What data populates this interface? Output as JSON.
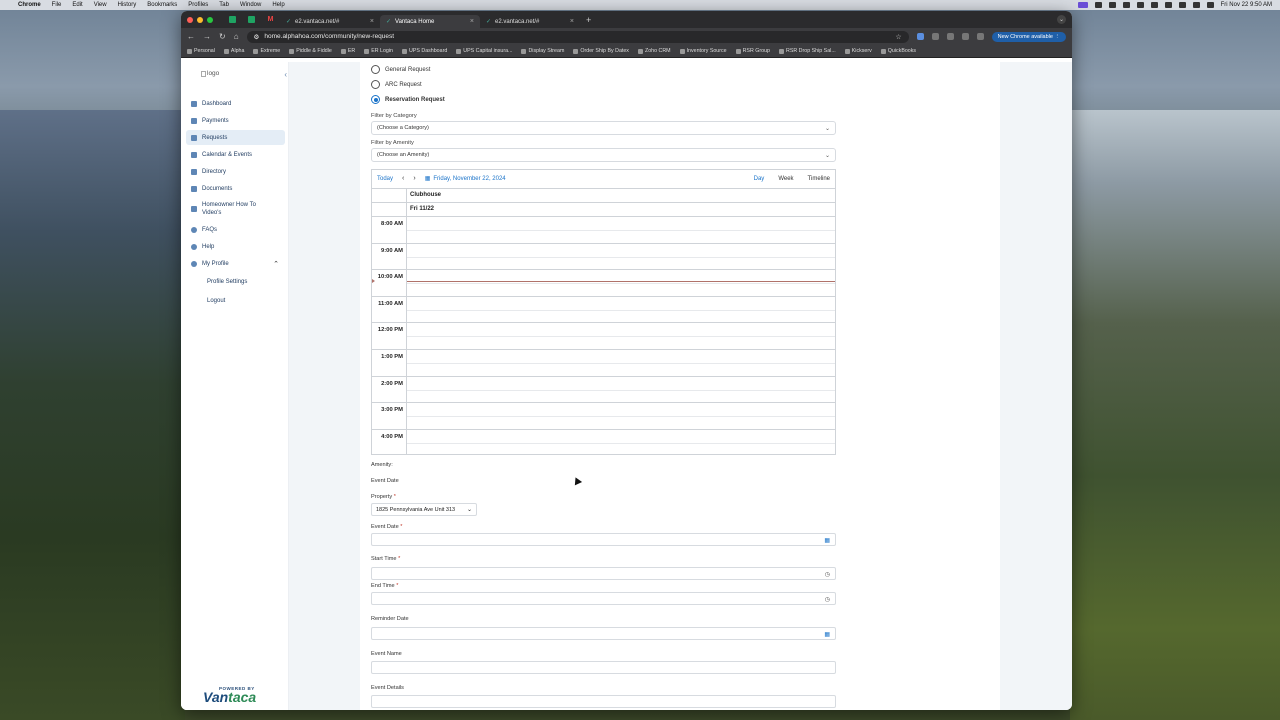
{
  "menubar": {
    "app": "Chrome",
    "items": [
      "File",
      "Edit",
      "View",
      "History",
      "Bookmarks",
      "Profiles",
      "Tab",
      "Window",
      "Help"
    ],
    "clock": "Fri Nov 22  9:50 AM"
  },
  "browser": {
    "tabs": [
      {
        "label": "e2.vantaca.net/#",
        "active": false
      },
      {
        "label": "Vantaca Home",
        "active": true
      },
      {
        "label": "e2.vantaca.net/#",
        "active": false
      }
    ],
    "url": "home.alphahoa.com/community/new-request",
    "new_chrome_label": "New Chrome available",
    "bookmarks": [
      "Personal",
      "Alpha",
      "Extreme",
      "Piddle & Fiddle",
      "ER",
      "ER Login",
      "UPS Dashboard",
      "UPS Capital insura...",
      "Display Stream",
      "Order Ship By Datex",
      "Zoho CRM",
      "Inventory Source",
      "RSR Group",
      "RSR Drop Ship Sal...",
      "Kickserv",
      "QuickBooks"
    ]
  },
  "sidebar": {
    "logo_alt": "logo",
    "items": [
      {
        "label": "Dashboard",
        "icon": "dashboard-icon",
        "active": false
      },
      {
        "label": "Payments",
        "icon": "payments-icon",
        "active": false
      },
      {
        "label": "Requests",
        "icon": "requests-icon",
        "active": true
      },
      {
        "label": "Calendar & Events",
        "icon": "calendar-icon",
        "active": false
      },
      {
        "label": "Directory",
        "icon": "directory-icon",
        "active": false
      },
      {
        "label": "Documents",
        "icon": "documents-icon",
        "active": false
      },
      {
        "label": "Homeowner How To Video's",
        "icon": "video-icon",
        "active": false
      },
      {
        "label": "FAQs",
        "icon": "faq-icon",
        "active": false
      },
      {
        "label": "Help",
        "icon": "help-icon",
        "active": false
      },
      {
        "label": "My Profile",
        "icon": "profile-icon",
        "active": false
      }
    ],
    "profile_sub": [
      "Profile Settings",
      "Logout"
    ],
    "powered_by": "POWERED BY",
    "brand_a": "Van",
    "brand_b": "taca"
  },
  "form": {
    "request_types": [
      {
        "label": "General Request",
        "selected": false
      },
      {
        "label": "ARC Request",
        "selected": false
      },
      {
        "label": "Reservation Request",
        "selected": true
      }
    ],
    "filter_category_label": "Filter by Category",
    "filter_category_value": "(Choose a Category)",
    "filter_amenity_label": "Filter by Amenity",
    "filter_amenity_value": "(Choose an Amenity)",
    "amenity_label": "Amenity:",
    "event_date_heading": "Event Date",
    "property_label": "Property",
    "property_value": "1825 Pennsylvania Ave Unit 313",
    "event_date_label": "Event Date",
    "start_time_label": "Start Time",
    "end_time_label": "End Time",
    "reminder_date_label": "Reminder Date",
    "event_name_label": "Event Name",
    "event_details_label": "Event Details",
    "required_mark": "*"
  },
  "calendar": {
    "today_label": "Today",
    "date_label": "Friday, November 22, 2024",
    "views": [
      "Day",
      "Week",
      "Timeline"
    ],
    "active_view": "Day",
    "resource": "Clubhouse",
    "day_header": "Fri 11/22",
    "hours": [
      "8:00 AM",
      "9:00 AM",
      "10:00 AM",
      "11:00 AM",
      "12:00 PM",
      "1:00 PM",
      "2:00 PM",
      "3:00 PM",
      "4:00 PM"
    ]
  }
}
